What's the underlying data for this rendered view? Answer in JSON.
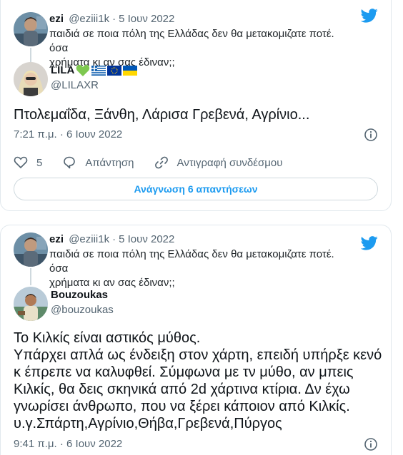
{
  "tweets": [
    {
      "quoted": {
        "name": "ezi",
        "handle": "@eziii1k",
        "date": "5 Ιουν 2022",
        "text_lines": [
          "παιδιά σε ποια πόλη της Ελλάδας δεν θα μετακομιζατε ποτέ. όσα",
          "χρήματα κι αν σας έδιναν;;"
        ]
      },
      "author": {
        "name": "LILA",
        "handle": "@LILAXR",
        "emojis": [
          "green-heart-icon",
          "greek-flag-icon",
          "eu-flag-icon",
          "ukraine-flag-icon"
        ]
      },
      "text_lines": [
        "Πτολεμαΐδα, Ξάνθη, Λάρισα Γρεβενά, Αγρίνιο..."
      ],
      "timestamp": "7:21 π.μ. · 6 Ιουν 2022",
      "actions": {
        "likes": "5",
        "reply_label": "Απάντηση",
        "copy_link_label": "Αντιγραφή συνδέσμου"
      },
      "read_replies_label": "Ανάγνωση 6 απαντήσεων"
    },
    {
      "quoted": {
        "name": "ezi",
        "handle": "@eziii1k",
        "date": "5 Ιουν 2022",
        "text_lines": [
          "παιδιά σε ποια πόλη της Ελλάδας δεν θα μετακομιζατε ποτέ. όσα",
          "χρήματα κι αν σας έδιναν;;"
        ]
      },
      "author": {
        "name": "Bouzoukas",
        "handle": "@bouzoukas"
      },
      "text_lines": [
        "Το Κιλκίς είναι αστικός μύθος.",
        "Υπάρχει απλά ως ένδειξη στον χάρτη, επειδή υπήρξε κενό",
        "κ έπρεπε να καλυφθεί. Σύμφωνα με τν μύθο, αν μπεις",
        "Κιλκίς, θα δεις σκηνικά από 2d χάρτινα κτίρια. Δν έχω",
        "γνωρίσει άνθρωπο, που να ξέρει κάποιον από Κιλκίς.",
        "υ.γ.Σπάρτη,Αγρίνιο,Θήβα,Γρεβενά,Πύργος"
      ],
      "timestamp": "9:41 π.μ. · 6 Ιουν 2022"
    }
  ],
  "colors": {
    "accent": "#1d9bf0",
    "secondary_text": "#536471",
    "border": "#cfd9de"
  }
}
